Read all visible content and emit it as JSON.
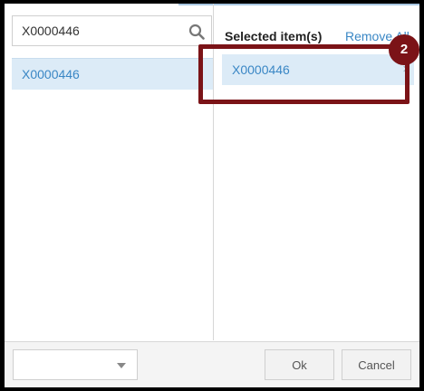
{
  "search": {
    "value": "X0000446"
  },
  "results": {
    "items": [
      {
        "label": "X0000446"
      }
    ]
  },
  "selected": {
    "title": "Selected item(s)",
    "remove_all_label": "Remove All",
    "items": [
      {
        "label": "X0000446",
        "remove_glyph": "×"
      }
    ]
  },
  "annotation": {
    "step_number": "2",
    "color": "#7b1317"
  },
  "footer": {
    "dropdown_value": "",
    "ok_label": "Ok",
    "cancel_label": "Cancel"
  },
  "colors": {
    "accent": "#3a87c5",
    "selection_bg": "#dcebf7"
  }
}
